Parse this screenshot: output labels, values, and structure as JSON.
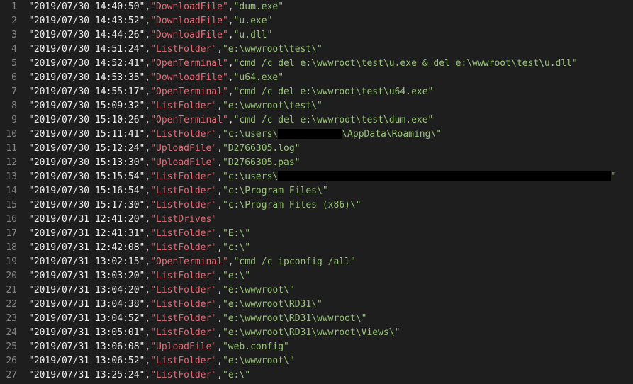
{
  "lines": [
    {
      "n": 1,
      "ts": "\"2019/07/30 14:40:50\"",
      "cmd": "\"DownloadFile\"",
      "arg": "\"dum.exe\""
    },
    {
      "n": 2,
      "ts": "\"2019/07/30 14:43:52\"",
      "cmd": "\"DownloadFile\"",
      "arg": "\"u.exe\""
    },
    {
      "n": 3,
      "ts": "\"2019/07/30 14:44:26\"",
      "cmd": "\"DownloadFile\"",
      "arg": "\"u.dll\""
    },
    {
      "n": 4,
      "ts": "\"2019/07/30 14:51:24\"",
      "cmd": "\"ListFolder\"",
      "arg": "\"e:\\wwwroot\\test\\\""
    },
    {
      "n": 5,
      "ts": "\"2019/07/30 14:52:41\"",
      "cmd": "\"OpenTerminal\"",
      "arg": "\"cmd /c del e:\\wwwroot\\test\\u.exe & del e:\\wwwroot\\test\\u.dll\""
    },
    {
      "n": 6,
      "ts": "\"2019/07/30 14:53:35\"",
      "cmd": "\"DownloadFile\"",
      "arg": "\"u64.exe\""
    },
    {
      "n": 7,
      "ts": "\"2019/07/30 14:55:17\"",
      "cmd": "\"OpenTerminal\"",
      "arg": "\"cmd /c del e:\\wwwroot\\test\\u64.exe\""
    },
    {
      "n": 8,
      "ts": "\"2019/07/30 15:09:32\"",
      "cmd": "\"ListFolder\"",
      "arg": "\"e:\\wwwroot\\test\\\""
    },
    {
      "n": 9,
      "ts": "\"2019/07/30 15:10:26\"",
      "cmd": "\"OpenTerminal\"",
      "arg": "\"cmd /c del e:\\wwwroot\\test\\dum.exe\""
    },
    {
      "n": 10,
      "ts": "\"2019/07/30 15:11:41\"",
      "cmd": "\"ListFolder\"",
      "arg_pre": "\"c:\\users\\",
      "arg_post": "\\AppData\\Roaming\\\"",
      "redact_w": 90
    },
    {
      "n": 11,
      "ts": "\"2019/07/30 15:12:24\"",
      "cmd": "\"UploadFile\"",
      "arg": "\"D2766305.log\""
    },
    {
      "n": 12,
      "ts": "\"2019/07/30 15:13:30\"",
      "cmd": "\"UploadFile\"",
      "arg": "\"D2766305.pas\""
    },
    {
      "n": 13,
      "ts": "\"2019/07/30 15:15:54\"",
      "cmd": "\"ListFolder\"",
      "arg_pre": "\"c:\\users\\",
      "arg_post": "\"",
      "redact_w": 470
    },
    {
      "n": 14,
      "ts": "\"2019/07/30 15:16:54\"",
      "cmd": "\"ListFolder\"",
      "arg": "\"c:\\Program Files\\\""
    },
    {
      "n": 15,
      "ts": "\"2019/07/30 15:17:30\"",
      "cmd": "\"ListFolder\"",
      "arg": "\"c:\\Program Files (x86)\\\""
    },
    {
      "n": 16,
      "ts": "\"2019/07/31 12:41:20\"",
      "cmd": "\"ListDrives\""
    },
    {
      "n": 17,
      "ts": "\"2019/07/31 12:41:31\"",
      "cmd": "\"ListFolder\"",
      "arg": "\"E:\\\""
    },
    {
      "n": 18,
      "ts": "\"2019/07/31 12:42:08\"",
      "cmd": "\"ListFolder\"",
      "arg": "\"c:\\\""
    },
    {
      "n": 19,
      "ts": "\"2019/07/31 13:02:15\"",
      "cmd": "\"OpenTerminal\"",
      "arg": "\"cmd /c ipconfig /all\""
    },
    {
      "n": 20,
      "ts": "\"2019/07/31 13:03:20\"",
      "cmd": "\"ListFolder\"",
      "arg": "\"e:\\\""
    },
    {
      "n": 21,
      "ts": "\"2019/07/31 13:04:20\"",
      "cmd": "\"ListFolder\"",
      "arg": "\"e:\\wwwroot\\\""
    },
    {
      "n": 22,
      "ts": "\"2019/07/31 13:04:38\"",
      "cmd": "\"ListFolder\"",
      "arg": "\"e:\\wwwroot\\RD31\\\""
    },
    {
      "n": 23,
      "ts": "\"2019/07/31 13:04:52\"",
      "cmd": "\"ListFolder\"",
      "arg": "\"e:\\wwwroot\\RD31\\wwwroot\\\""
    },
    {
      "n": 24,
      "ts": "\"2019/07/31 13:05:01\"",
      "cmd": "\"ListFolder\"",
      "arg": "\"e:\\wwwroot\\RD31\\wwwroot\\Views\\\""
    },
    {
      "n": 25,
      "ts": "\"2019/07/31 13:06:08\"",
      "cmd": "\"UploadFile\"",
      "arg": "\"web.config\""
    },
    {
      "n": 26,
      "ts": "\"2019/07/31 13:06:52\"",
      "cmd": "\"ListFolder\"",
      "arg": "\"e:\\wwwroot\\\""
    },
    {
      "n": 27,
      "ts": "\"2019/07/31 13:25:24\"",
      "cmd": "\"ListFolder\"",
      "arg": "\"e:\\\""
    }
  ]
}
